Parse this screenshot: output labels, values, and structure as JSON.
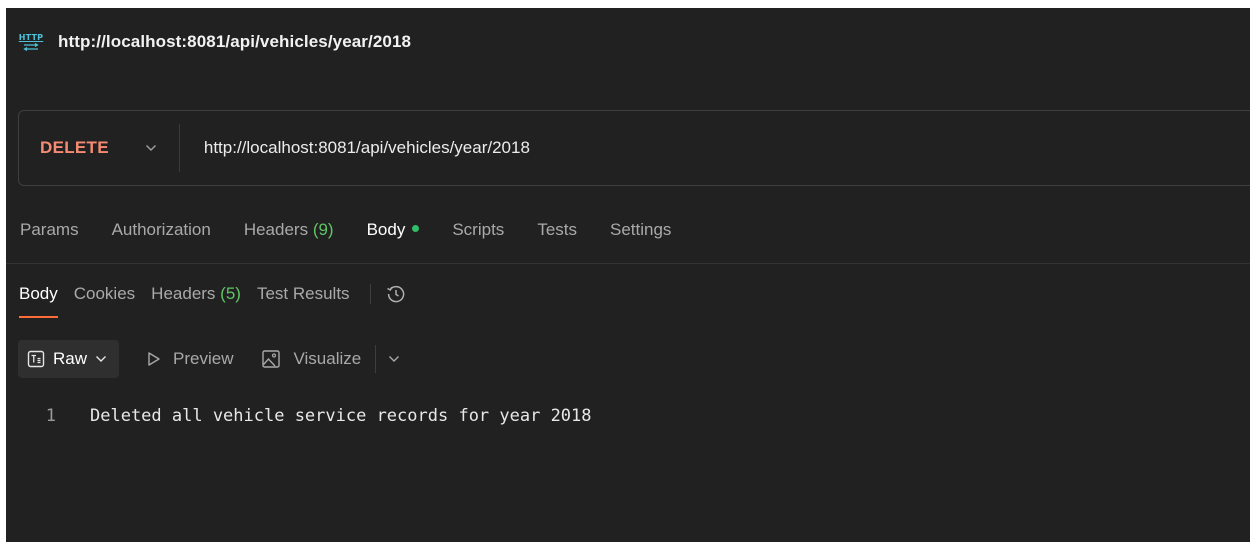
{
  "request": {
    "title": "http://localhost:8081/api/vehicles/year/2018",
    "method": "DELETE",
    "url": "http://localhost:8081/api/vehicles/year/2018"
  },
  "request_tabs": {
    "params": "Params",
    "authorization": "Authorization",
    "headers_label": "Headers",
    "headers_count": "(9)",
    "body": "Body",
    "scripts": "Scripts",
    "tests": "Tests",
    "settings": "Settings"
  },
  "response_tabs": {
    "body": "Body",
    "cookies": "Cookies",
    "headers_label": "Headers",
    "headers_count": "(5)",
    "test_results": "Test Results"
  },
  "format_bar": {
    "raw": "Raw",
    "preview": "Preview",
    "visualize": "Visualize"
  },
  "response_body": {
    "lines": [
      {
        "number": "1",
        "text": "Deleted all vehicle service records for year 2018"
      }
    ]
  },
  "icons": {
    "request_type": "http-icon",
    "method_dropdown": "chevron-down-icon",
    "history": "history-icon",
    "raw_format": "text-format-icon",
    "preview": "play-outline-icon",
    "visualize": "image-icon"
  },
  "colors": {
    "background": "#212121",
    "method_delete": "#f58b73",
    "count_green": "#5fc566",
    "body_dot": "#2fbf6a",
    "active_underline": "#ff6c37"
  }
}
